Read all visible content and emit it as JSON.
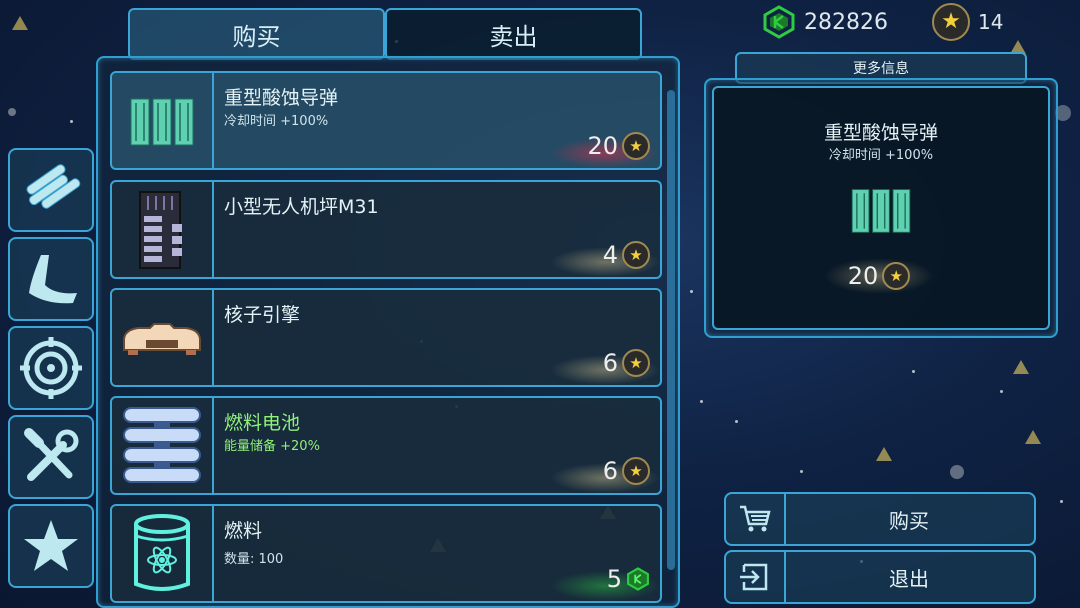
{
  "tabs": {
    "buy": "购买",
    "sell": "卖出"
  },
  "currency": {
    "gems": "282826",
    "stars": "14"
  },
  "more_info_label": "更多信息",
  "detail": {
    "name": "重型酸蚀导弹",
    "stat": "冷却时间 +100%",
    "price": "20",
    "price_icon": "star-coin-icon"
  },
  "categories": [
    {
      "icon": "missiles-icon"
    },
    {
      "icon": "hull-wing-icon"
    },
    {
      "icon": "target-icon"
    },
    {
      "icon": "tools-icon"
    },
    {
      "icon": "star-icon"
    }
  ],
  "items": [
    {
      "name": "重型酸蚀导弹",
      "sub": "冷却时间 +100%",
      "price": "20",
      "price_icon": "star-coin-icon",
      "icon": "missile-pods-icon",
      "affordable": false
    },
    {
      "name": "小型无人机坪M31",
      "sub": "",
      "price": "4",
      "price_icon": "star-coin-icon",
      "icon": "drone-bay-icon",
      "affordable": true
    },
    {
      "name": "核子引擎",
      "sub": "",
      "price": "6",
      "price_icon": "star-coin-icon",
      "icon": "nuclear-engine-icon",
      "affordable": true
    },
    {
      "name": "燃料电池",
      "sub": "能量储备 +20%",
      "price": "6",
      "price_icon": "star-coin-icon",
      "icon": "fuel-cell-icon",
      "affordable": true
    },
    {
      "name": "燃料",
      "sub": "数量: 100",
      "price": "5",
      "price_icon": "green-gem-icon",
      "icon": "fuel-barrel-icon",
      "affordable": true
    }
  ],
  "actions": {
    "buy": "购买",
    "exit": "退出"
  },
  "colors": {
    "accent": "#3aa6d6",
    "gem": "#2ecc40",
    "coin": "#f3cf3e",
    "unaffordable_glow": "#e0304a",
    "affordable_glow": "#d8c890"
  }
}
